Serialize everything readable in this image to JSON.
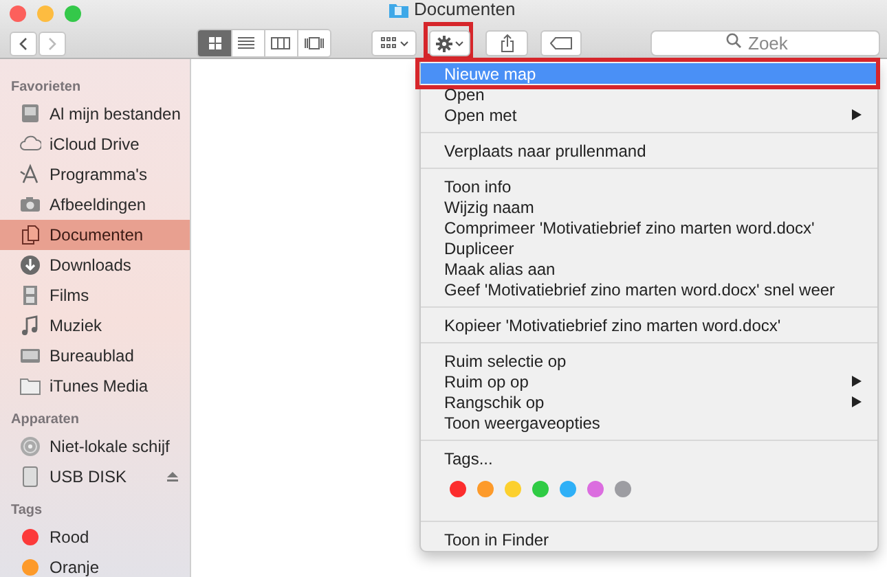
{
  "window": {
    "title": "Documenten"
  },
  "toolbar": {
    "view_modes": [
      {
        "selected": true
      },
      {
        "selected": false
      },
      {
        "selected": false
      },
      {
        "selected": false
      }
    ],
    "action_button": {
      "annotated": true
    },
    "search": {
      "placeholder": "Zoek"
    }
  },
  "sidebar": {
    "sections": [
      {
        "title": "Favorieten",
        "items": [
          {
            "label": "Al mijn bestanden",
            "selected": false
          },
          {
            "label": "iCloud Drive",
            "selected": false
          },
          {
            "label": "Programma's",
            "selected": false
          },
          {
            "label": "Afbeeldingen",
            "selected": false
          },
          {
            "label": "Documenten",
            "selected": true
          },
          {
            "label": "Downloads",
            "selected": false
          },
          {
            "label": "Films",
            "selected": false
          },
          {
            "label": "Muziek",
            "selected": false
          },
          {
            "label": "Bureaublad",
            "selected": false
          },
          {
            "label": "iTunes Media",
            "selected": false
          }
        ]
      },
      {
        "title": "Apparaten",
        "items": [
          {
            "label": "Niet-lokale schijf",
            "selected": false,
            "ejectable": false
          },
          {
            "label": "USB DISK",
            "selected": false,
            "ejectable": true
          }
        ]
      },
      {
        "title": "Tags",
        "items": [
          {
            "label": "Rood",
            "selected": false,
            "color": "#fc3a3a"
          },
          {
            "label": "Oranje",
            "selected": false,
            "color": "#fd9a2a"
          }
        ]
      }
    ]
  },
  "context_menu": {
    "items": [
      {
        "kind": "item",
        "label": "Nieuwe map",
        "highlighted": true,
        "submenu": false,
        "annotated": true
      },
      {
        "kind": "item",
        "label": "Open",
        "highlighted": false,
        "submenu": false
      },
      {
        "kind": "item",
        "label": "Open met",
        "highlighted": false,
        "submenu": true
      },
      {
        "kind": "separator"
      },
      {
        "kind": "item",
        "label": "Verplaats naar prullenmand",
        "highlighted": false,
        "submenu": false
      },
      {
        "kind": "separator"
      },
      {
        "kind": "item",
        "label": "Toon info",
        "highlighted": false,
        "submenu": false
      },
      {
        "kind": "item",
        "label": "Wijzig naam",
        "highlighted": false,
        "submenu": false
      },
      {
        "kind": "item",
        "label": "Comprimeer 'Motivatiebrief zino marten word.docx'",
        "highlighted": false,
        "submenu": false
      },
      {
        "kind": "item",
        "label": "Dupliceer",
        "highlighted": false,
        "submenu": false
      },
      {
        "kind": "item",
        "label": "Maak alias aan",
        "highlighted": false,
        "submenu": false
      },
      {
        "kind": "item",
        "label": "Geef 'Motivatiebrief zino marten word.docx' snel weer",
        "highlighted": false,
        "submenu": false
      },
      {
        "kind": "separator"
      },
      {
        "kind": "item",
        "label": "Kopieer 'Motivatiebrief zino marten word.docx'",
        "highlighted": false,
        "submenu": false
      },
      {
        "kind": "separator"
      },
      {
        "kind": "item",
        "label": "Ruim selectie op",
        "highlighted": false,
        "submenu": false
      },
      {
        "kind": "item",
        "label": "Ruim op op",
        "highlighted": false,
        "submenu": true
      },
      {
        "kind": "item",
        "label": "Rangschik op",
        "highlighted": false,
        "submenu": true
      },
      {
        "kind": "item",
        "label": "Toon weergaveopties",
        "highlighted": false,
        "submenu": false
      },
      {
        "kind": "separator"
      },
      {
        "kind": "item",
        "label": "Tags...",
        "highlighted": false,
        "submenu": false
      },
      {
        "kind": "tags",
        "colors": [
          {
            "color": "#fc2d2d"
          },
          {
            "color": "#fd9a2a"
          },
          {
            "color": "#fcd02e"
          },
          {
            "color": "#2fcb44"
          },
          {
            "color": "#2fb0f7"
          },
          {
            "color": "#db6ddf"
          },
          {
            "color": "#9d9da2"
          }
        ]
      },
      {
        "kind": "separator"
      },
      {
        "kind": "item",
        "label": "Toon in Finder",
        "highlighted": false,
        "submenu": false
      }
    ]
  }
}
